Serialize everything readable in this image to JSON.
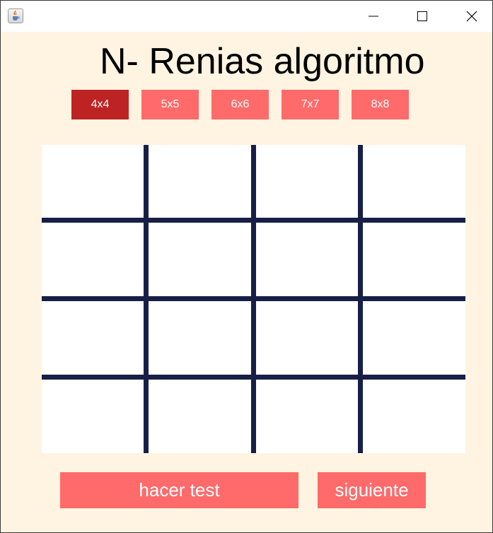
{
  "window": {
    "icon": "java-cup-icon",
    "controls": [
      "minimize-icon",
      "maximize-icon",
      "close-icon"
    ]
  },
  "heading": "N- Renias algoritmo",
  "size_buttons": [
    {
      "label": "4x4",
      "active": true
    },
    {
      "label": "5x5",
      "active": false
    },
    {
      "label": "6x6",
      "active": false
    },
    {
      "label": "7x7",
      "active": false
    },
    {
      "label": "8x8",
      "active": false
    }
  ],
  "board": {
    "rows": 4,
    "cols": 4,
    "line_color": "#171f47",
    "cell_color": "#ffffff"
  },
  "actions": {
    "test_label": "hacer test",
    "next_label": "siguiente"
  },
  "colors": {
    "background": "#fff4e1",
    "button": "#ff6a6a",
    "button_active": "#bd2323"
  }
}
